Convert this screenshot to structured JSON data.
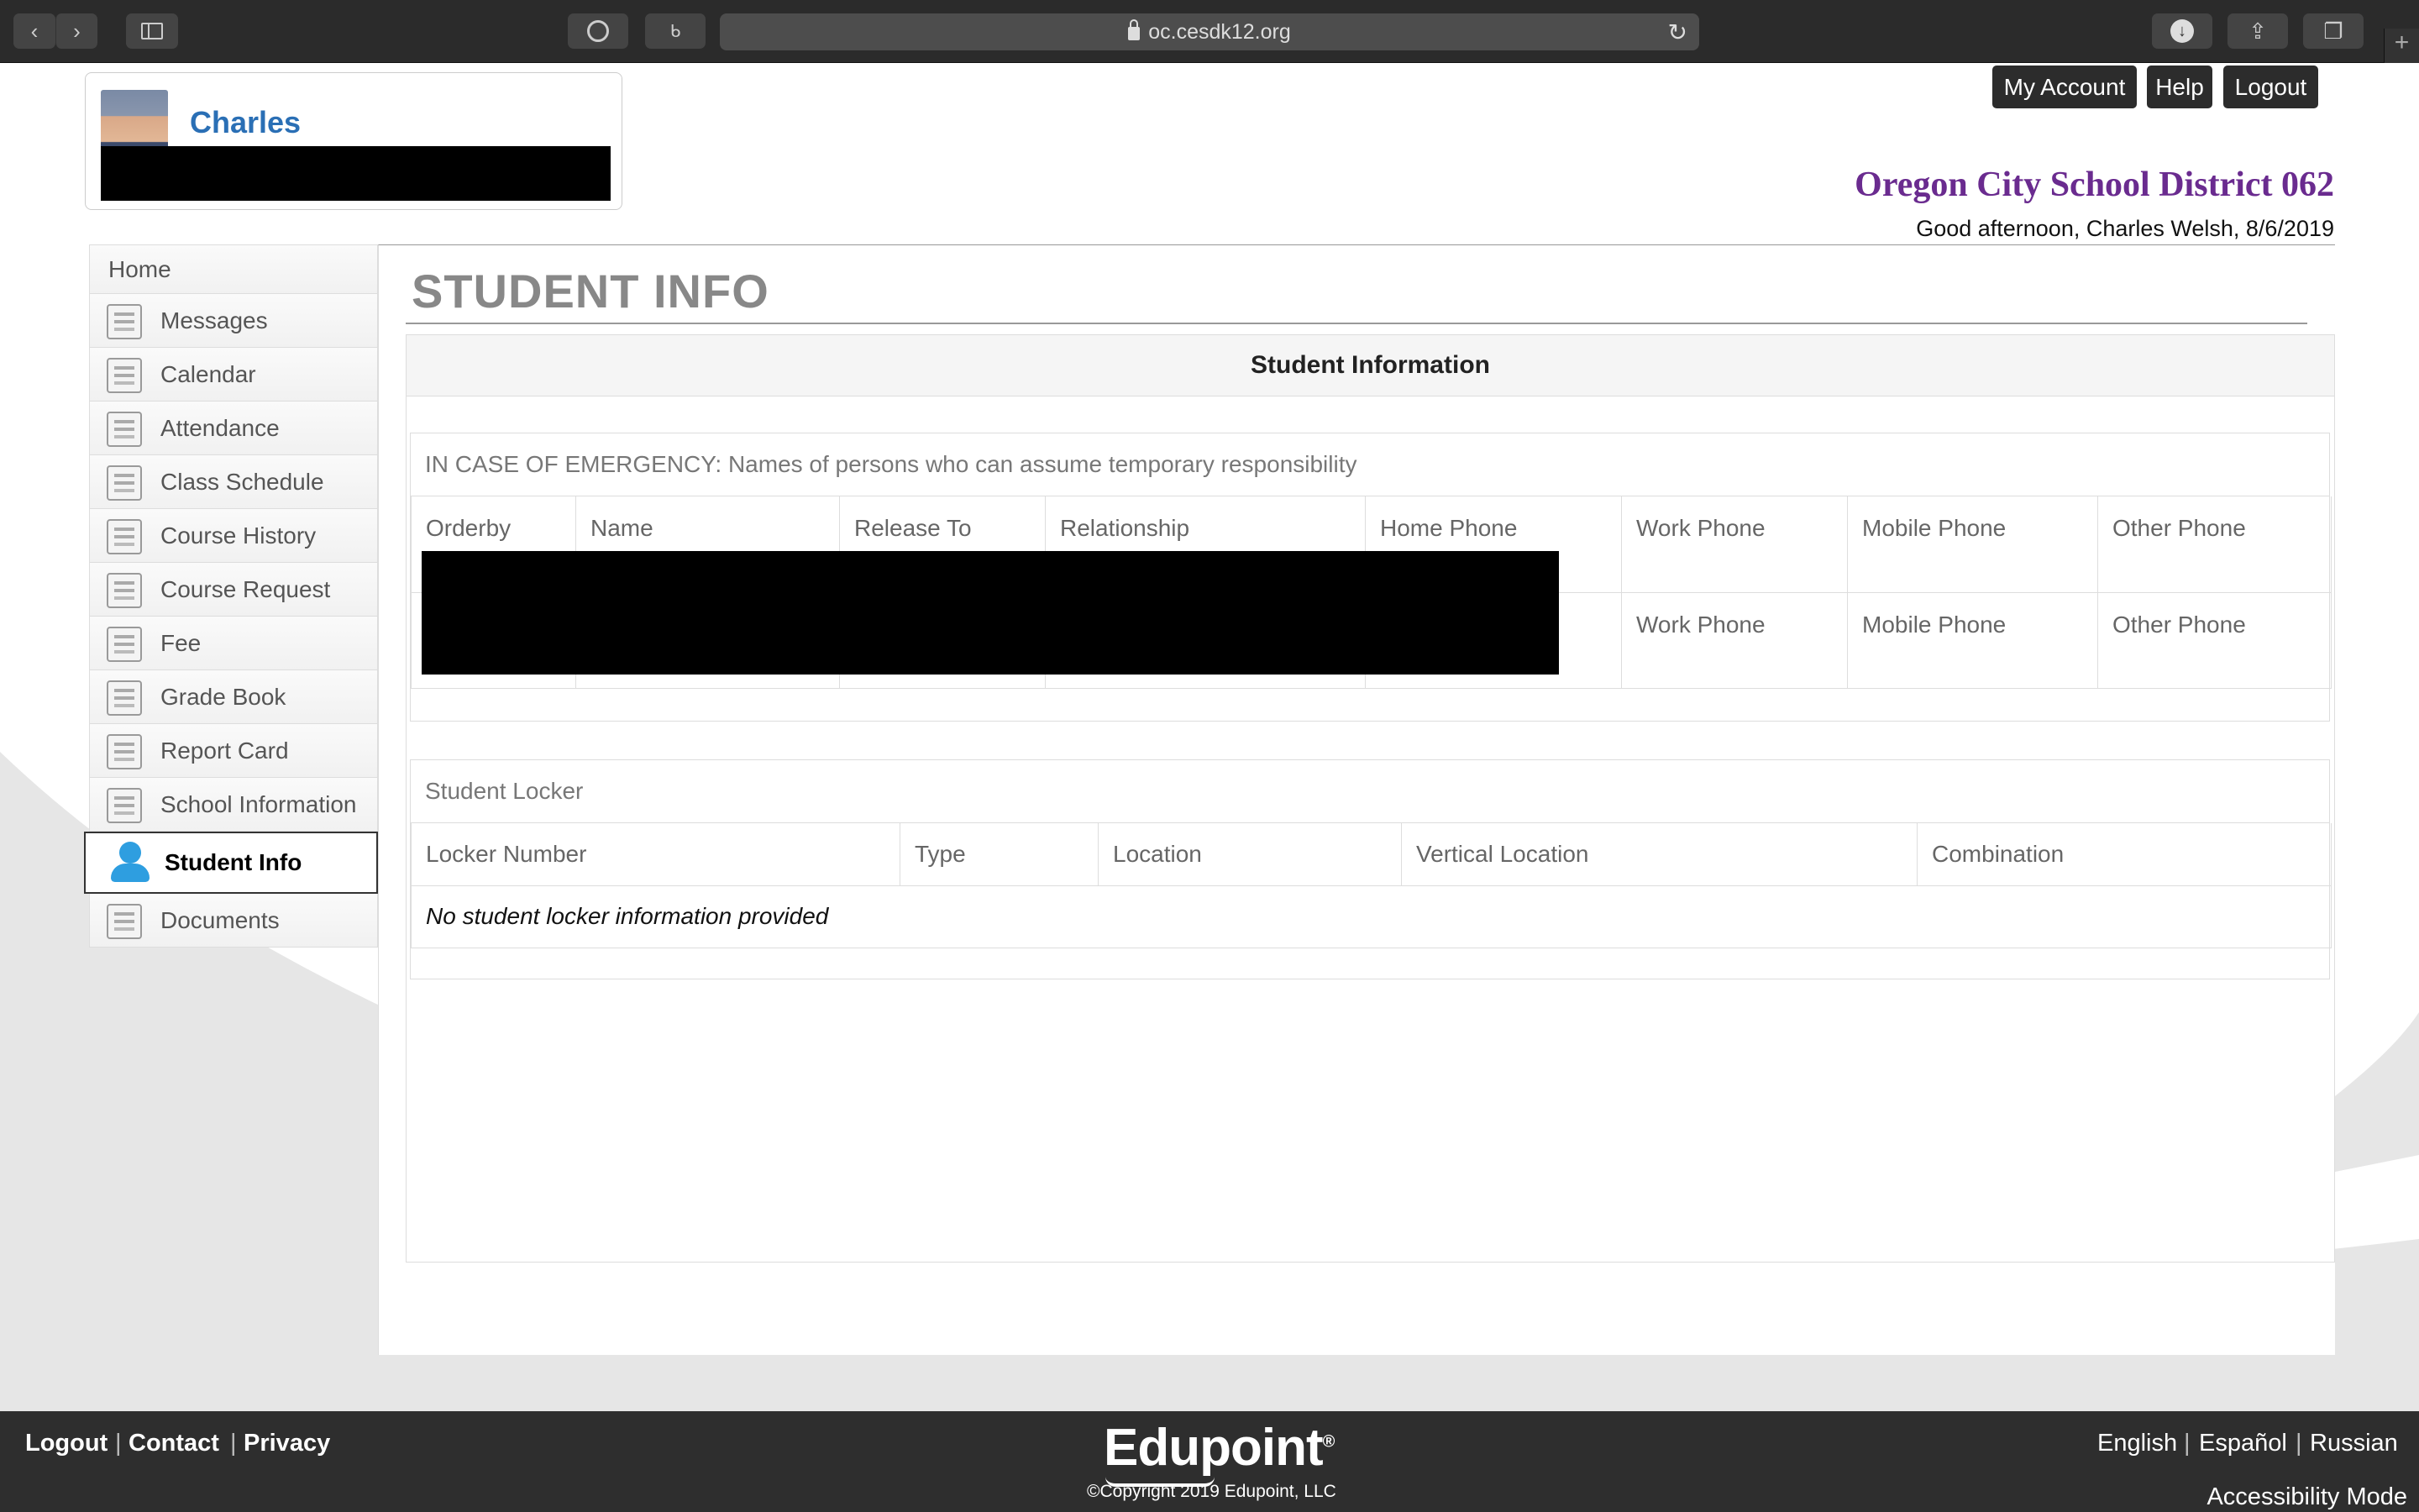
{
  "browser": {
    "url": "oc.cesdk12.org",
    "back_icon": "chevron-left-icon",
    "forward_icon": "chevron-right-icon",
    "plus_label": "+"
  },
  "header": {
    "student_name": "Charles",
    "my_account_label": "My Account",
    "help_label": "Help",
    "logout_label": "Logout",
    "district": "Oregon City School District 062",
    "greeting": "Good afternoon, Charles Welsh, 8/6/2019"
  },
  "sidebar": {
    "items": [
      {
        "label": "Home"
      },
      {
        "label": "Messages"
      },
      {
        "label": "Calendar"
      },
      {
        "label": "Attendance"
      },
      {
        "label": "Class Schedule"
      },
      {
        "label": "Course History"
      },
      {
        "label": "Course Request"
      },
      {
        "label": "Fee"
      },
      {
        "label": "Grade Book"
      },
      {
        "label": "Report Card"
      },
      {
        "label": "School Information"
      },
      {
        "label": "Student Info"
      },
      {
        "label": "Documents"
      }
    ]
  },
  "main": {
    "title": "STUDENT INFO",
    "box_header": "Student Information",
    "emergency": {
      "title": "IN CASE OF EMERGENCY: Names of persons who can assume temporary responsibility",
      "columns": [
        "Orderby",
        "Name",
        "Release To",
        "Relationship",
        "Home Phone",
        "Work Phone",
        "Mobile Phone",
        "Other Phone"
      ],
      "row2": [
        "Work Phone",
        "Mobile Phone",
        "Other Phone"
      ]
    },
    "locker": {
      "title": "Student Locker",
      "columns": [
        "Locker Number",
        "Type",
        "Location",
        "Vertical Location",
        "Combination"
      ],
      "empty_message": "No student locker information provided"
    }
  },
  "footer": {
    "logout": "Logout",
    "contact": "Contact",
    "privacy": "Privacy",
    "separator": "|",
    "logo": "Edupoint",
    "logo_mark": "®",
    "copyright": "©Copyright 2019 Edupoint, LLC",
    "lang_english": "English",
    "lang_espanol": "Español",
    "lang_russian": "Russian",
    "accessibility": "Accessibility Mode"
  }
}
